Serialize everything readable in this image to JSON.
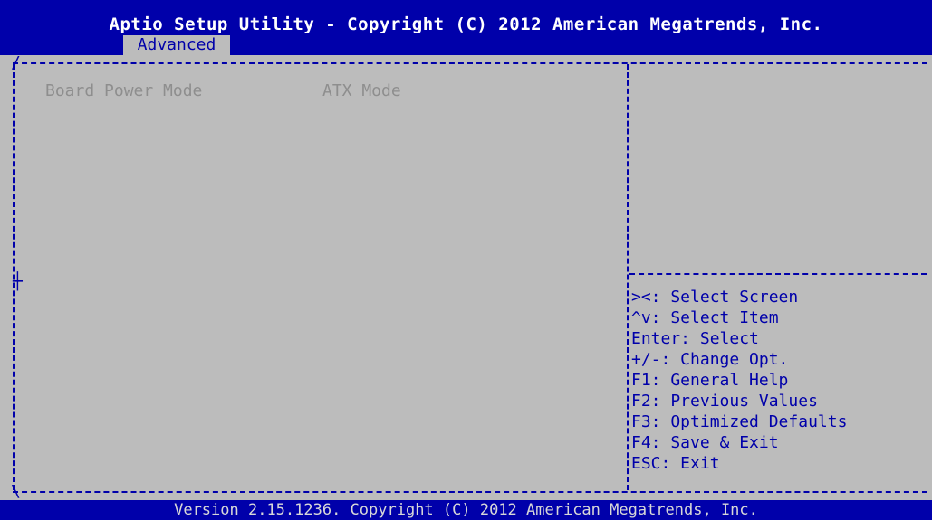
{
  "header": {
    "title": "Aptio Setup Utility - Copyright (C) 2012 American Megatrends, Inc.",
    "active_tab": "Advanced"
  },
  "settings": [
    {
      "name": "Board Power Mode",
      "value": "ATX Mode"
    }
  ],
  "help_keys": [
    "><: Select Screen",
    "^v: Select Item",
    "Enter: Select",
    "+/-: Change Opt.",
    "F1: General Help",
    "F2: Previous Values",
    "F3: Optimized Defaults",
    "F4: Save & Exit",
    "ESC: Exit"
  ],
  "footer": {
    "version_text": "Version 2.15.1236. Copyright (C) 2012 American Megatrends, Inc."
  },
  "colors": {
    "background_blue": "#0000aa",
    "panel_gray": "#bcbcbc",
    "disabled_text": "#8e8e8e",
    "help_text": "#0000aa",
    "title_text": "#ffffff"
  }
}
